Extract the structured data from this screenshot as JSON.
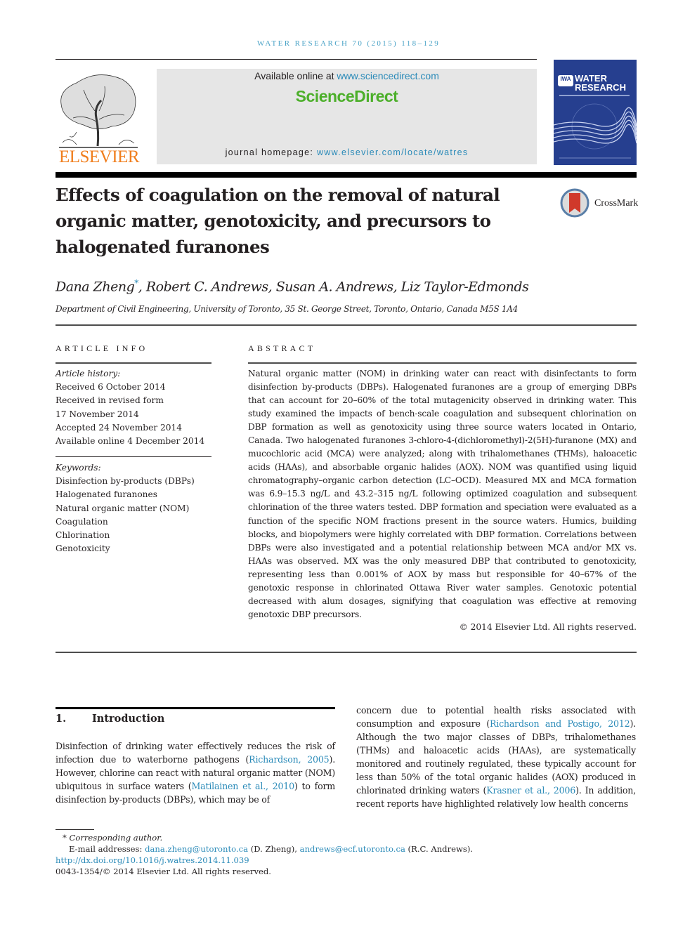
{
  "running_head": "WATER RESEARCH 70 (2015) 118–129",
  "publisher": {
    "logo_icon": "elsevier-tree-icon",
    "name": "ELSEVIER"
  },
  "banner": {
    "available_prefix": "Available online at ",
    "available_link": "www.sciencedirect.com",
    "brand": "ScienceDirect",
    "homepage_prefix": "journal homepage: ",
    "homepage_link": "www.elsevier.com/locate/watres"
  },
  "journal_cover": {
    "icon": "journal-cover-icon",
    "badge": "IWA",
    "title_line1": "WATER",
    "title_line2": "RESEARCH"
  },
  "colors": {
    "link": "#2a8ab8",
    "running_head": "#4ba3c7",
    "elsevier_orange": "#f07e1d",
    "sciencedirect_green": "#4caf2a",
    "banner_bg": "#e6e6e6",
    "cover_blue": "#263f8f"
  },
  "article": {
    "title": "Effects of coagulation on the removal of natural organic matter, genotoxicity, and precursors to halogenated furanones",
    "crossmark_label": "CrossMark",
    "authors": {
      "first": "Dana Zheng",
      "first_mark": "*",
      "rest": ", Robert C. Andrews, Susan A. Andrews, Liz Taylor-Edmonds"
    },
    "affiliation": "Department of Civil Engineering, University of Toronto, 35 St. George Street, Toronto, Ontario, Canada M5S 1A4"
  },
  "article_info": {
    "heading": "ARTICLE INFO",
    "history_label": "Article history:",
    "history": [
      "Received 6 October 2014",
      "Received in revised form",
      "17 November 2014",
      "Accepted 24 November 2014",
      "Available online 4 December 2014"
    ],
    "keywords_label": "Keywords:",
    "keywords": [
      "Disinfection by-products (DBPs)",
      "Halogenated furanones",
      "Natural organic matter (NOM)",
      "Coagulation",
      "Chlorination",
      "Genotoxicity"
    ]
  },
  "abstract": {
    "heading": "ABSTRACT",
    "text": "Natural organic matter (NOM) in drinking water can react with disinfectants to form disinfection by-products (DBPs). Halogenated furanones are a group of emerging DBPs that can account for 20–60% of the total mutagenicity observed in drinking water. This study examined the impacts of bench-scale coagulation and subsequent chlorination on DBP formation as well as genotoxicity using three source waters located in Ontario, Canada. Two halogenated furanones 3-chloro-4-(dichloromethyl)-2(5H)-furanone (MX) and mucochloric acid (MCA) were analyzed; along with trihalomethanes (THMs), haloacetic acids (HAAs), and absorbable organic halides (AOX). NOM was quantified using liquid chromatography–organic carbon detection (LC–OCD). Measured MX and MCA formation was 6.9–15.3 ng/L and 43.2–315 ng/L following optimized coagulation and subsequent chlorination of the three waters tested. DBP formation and speciation were evaluated as a function of the specific NOM fractions present in the source waters. Humics, building blocks, and biopolymers were highly correlated with DBP formation. Correlations between DBPs were also investigated and a potential relationship between MCA and/or MX vs. HAAs was observed. MX was the only measured DBP that contributed to genotoxicity, representing less than 0.001% of AOX by mass but responsible for 40–67% of the genotoxic response in chlorinated Ottawa River water samples. Genotoxic potential decreased with alum dosages, signifying that coagulation was effective at removing genotoxic DBP precursors.",
    "copyright": "© 2014 Elsevier Ltd. All rights reserved."
  },
  "introduction": {
    "number": "1.",
    "heading": "Introduction",
    "left": [
      {
        "t": "Disinfection of drinking water effectively reduces the risk of infection due to waterborne pathogens ("
      },
      {
        "link": "Richardson, 2005"
      },
      {
        "t": "). However, chlorine can react with natural organic matter (NOM) ubiquitous in surface waters ("
      },
      {
        "link": "Matilainen et al., 2010"
      },
      {
        "t": ") to form disinfection by-products (DBPs), which may be of"
      }
    ],
    "right": [
      {
        "t": "concern due to potential health risks associated with consumption and exposure ("
      },
      {
        "link": "Richardson and Postigo, 2012"
      },
      {
        "t": "). Although the two major classes of DBPs, trihalomethanes (THMs) and haloacetic acids (HAAs), are systematically monitored and routinely regulated, these typically account for less than 50% of the total organic halides (AOX) produced in chlorinated drinking waters ("
      },
      {
        "link": "Krasner et al., 2006"
      },
      {
        "t": "). In addition, recent reports have highlighted relatively low health concerns"
      }
    ]
  },
  "footnotes": {
    "corresponding_mark": "*",
    "corresponding": "Corresponding author.",
    "email_label": "E-mail addresses: ",
    "email1": "dana.zheng@utoronto.ca",
    "email1_who": " (D. Zheng), ",
    "email2": "andrews@ecf.utoronto.ca",
    "email2_who": " (R.C. Andrews).",
    "doi": "http://dx.doi.org/10.1016/j.watres.2014.11.039",
    "issn_copyright": "0043-1354/© 2014 Elsevier Ltd. All rights reserved."
  }
}
